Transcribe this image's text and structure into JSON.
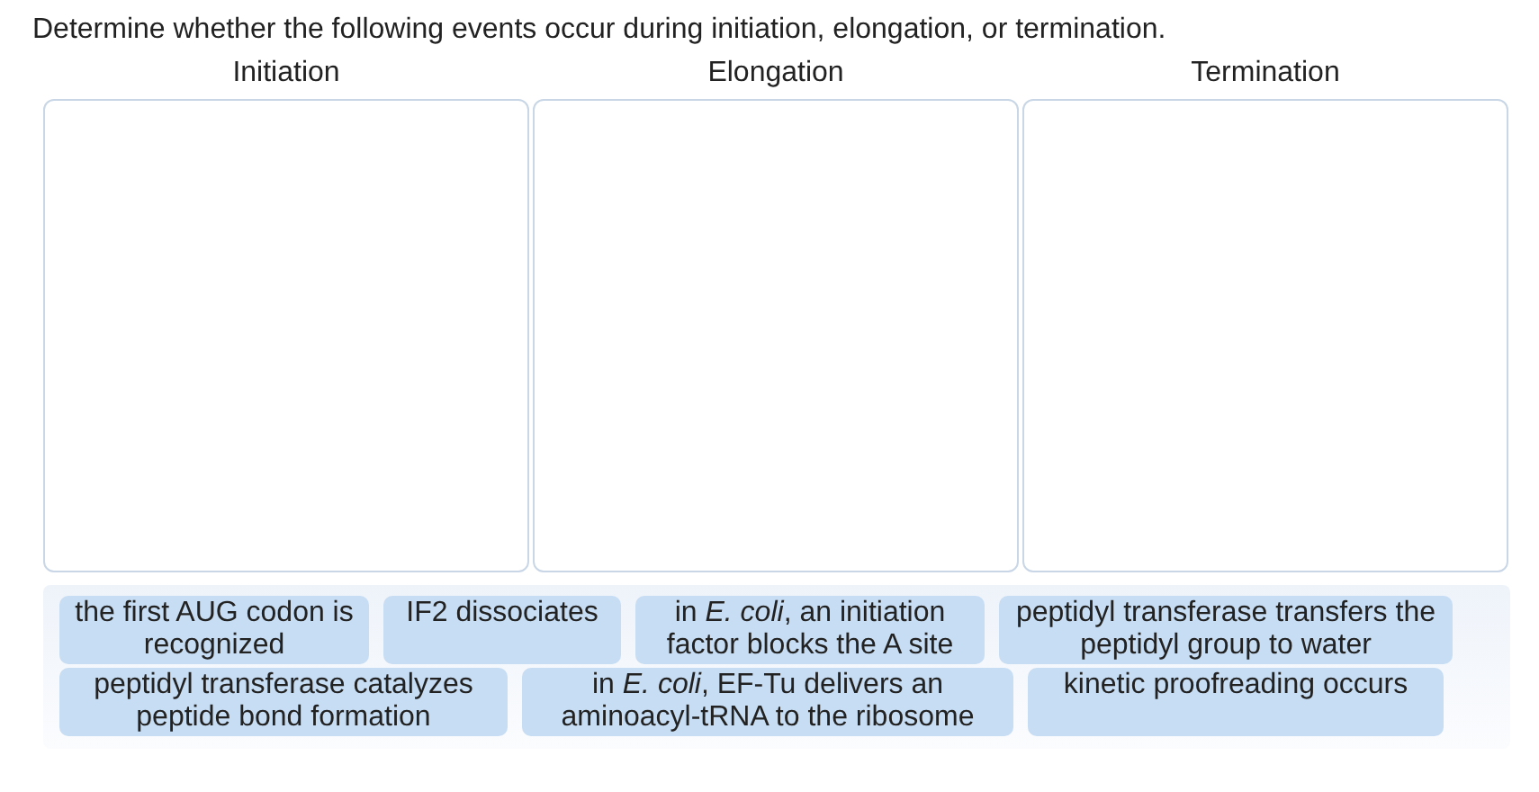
{
  "instruction": "Determine whether the following events occur during initiation, elongation, or termination.",
  "bins": [
    {
      "label": "Initiation"
    },
    {
      "label": "Elongation"
    },
    {
      "label": "Termination"
    }
  ],
  "answer_bank": [
    {
      "text": "the first AUG codon is recognized"
    },
    {
      "text": "IF2 dissociates"
    },
    {
      "text": "in *E. coli*, an initiation factor blocks the A site"
    },
    {
      "text": "peptidyl transferase transfers the peptidyl group to water"
    },
    {
      "text": "peptidyl transferase catalyzes peptide bond formation"
    },
    {
      "text": "in *E. coli*, EF-Tu delivers an aminoacyl-tRNA to the ribosome"
    },
    {
      "text": "kinetic proofreading occurs"
    }
  ]
}
